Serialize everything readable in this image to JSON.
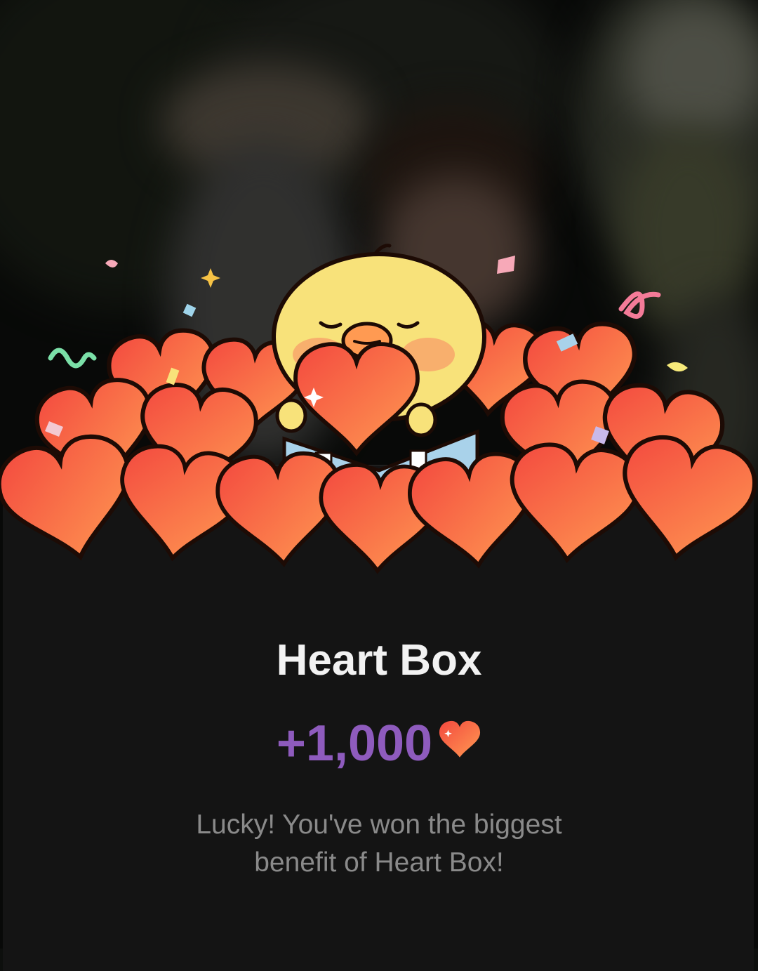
{
  "heart_box": {
    "title": "Heart Box",
    "reward_amount": "+1,000",
    "reward_icon": "heart-icon",
    "message_line1": "Lucky! You've won the biggest",
    "message_line2": "benefit of Heart Box!"
  },
  "illustration": {
    "character": "yellow-chick-holding-heart",
    "decoration": "pile-of-hearts-with-confetti"
  },
  "colors": {
    "accent_purple": "#8e5bbd",
    "heart_red": "#f3493f",
    "heart_orange": "#ff8a4a",
    "sheet_background": "#141414",
    "title_text": "#f2f2f2",
    "message_text": "#8a8a8a"
  }
}
